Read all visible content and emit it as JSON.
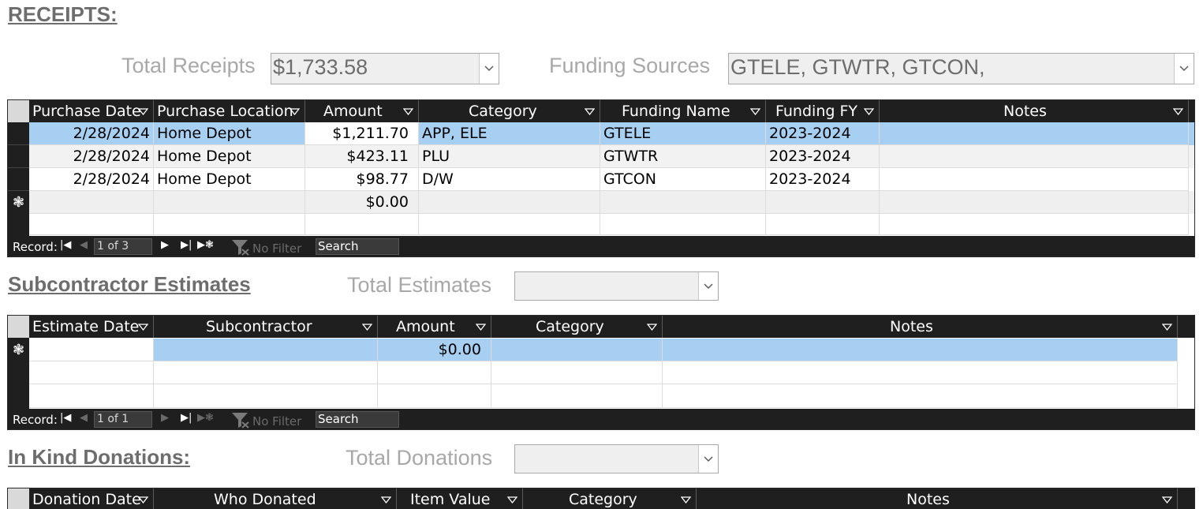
{
  "receipts": {
    "title": "RECEIPTS:",
    "total_label": "Total Receipts",
    "total_value": "$1,733.58",
    "funding_label": "Funding Sources",
    "funding_value": "GTELE, GTWTR, GTCON,",
    "columns": [
      "Purchase Date",
      "Purchase Location",
      "Amount",
      "Category",
      "Funding Name",
      "Funding FY",
      "Notes"
    ],
    "rows": [
      {
        "date": "2/28/2024",
        "location": "Home Depot",
        "amount": "$1,211.70",
        "category": "APP, ELE",
        "funding_name": "GTELE",
        "funding_fy": "2023-2024",
        "notes": ""
      },
      {
        "date": "2/28/2024",
        "location": "Home Depot",
        "amount": "$423.11",
        "category": "PLU",
        "funding_name": "GTWTR",
        "funding_fy": "2023-2024",
        "notes": ""
      },
      {
        "date": "2/28/2024",
        "location": "Home Depot",
        "amount": "$98.77",
        "category": "D/W",
        "funding_name": "GTCON",
        "funding_fy": "2023-2024",
        "notes": ""
      }
    ],
    "new_row_amount": "$0.00",
    "nav": {
      "record_label": "Record:",
      "position": "1 of 3",
      "filter": "No Filter",
      "search": "Search"
    }
  },
  "estimates": {
    "title": "Subcontractor Estimates",
    "total_label": "Total Estimates",
    "total_value": "",
    "columns": [
      "Estimate Date",
      "Subcontractor",
      "Amount",
      "Category",
      "Notes"
    ],
    "new_row_amount": "$0.00",
    "nav": {
      "record_label": "Record:",
      "position": "1 of 1",
      "filter": "No Filter",
      "search": "Search"
    }
  },
  "donations": {
    "title": "In Kind Donations:",
    "total_label": "Total Donations",
    "total_value": "",
    "columns": [
      "Donation Date",
      "Who Donated",
      "Item Value",
      "Category",
      "Notes"
    ]
  },
  "icons": {
    "new_record": "asterisk-icon",
    "dropdown": "chevron-down-icon",
    "column_sort": "triangle-down-icon",
    "filter": "funnel-icon",
    "first": "first-record-icon",
    "prev": "previous-record-icon",
    "next": "next-record-icon",
    "last": "last-record-icon",
    "new": "new-record-nav-icon"
  }
}
